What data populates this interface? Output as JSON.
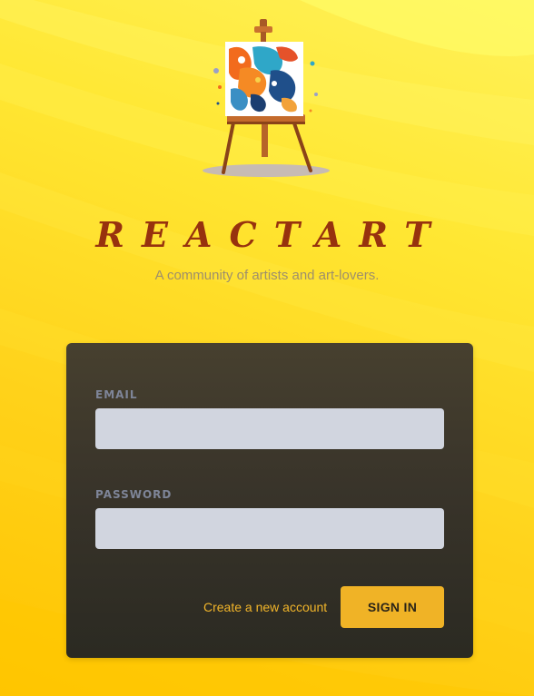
{
  "brand": {
    "title": "REACTART",
    "tagline": "A community of artists and art-lovers.",
    "logo_icon": "easel-painting-icon"
  },
  "form": {
    "email_label": "EMAIL",
    "email_value": "",
    "password_label": "PASSWORD",
    "password_value": "",
    "create_account_label": "Create a new account",
    "sign_in_label": "SIGN IN"
  },
  "colors": {
    "background_top": "#fff25a",
    "background_bottom": "#ffc400",
    "brand_title": "#97320e",
    "tagline": "#9e8f6b",
    "card": "#3a3529",
    "input": "#d1d5df",
    "accent": "#f0b326",
    "label": "#7e8598"
  }
}
